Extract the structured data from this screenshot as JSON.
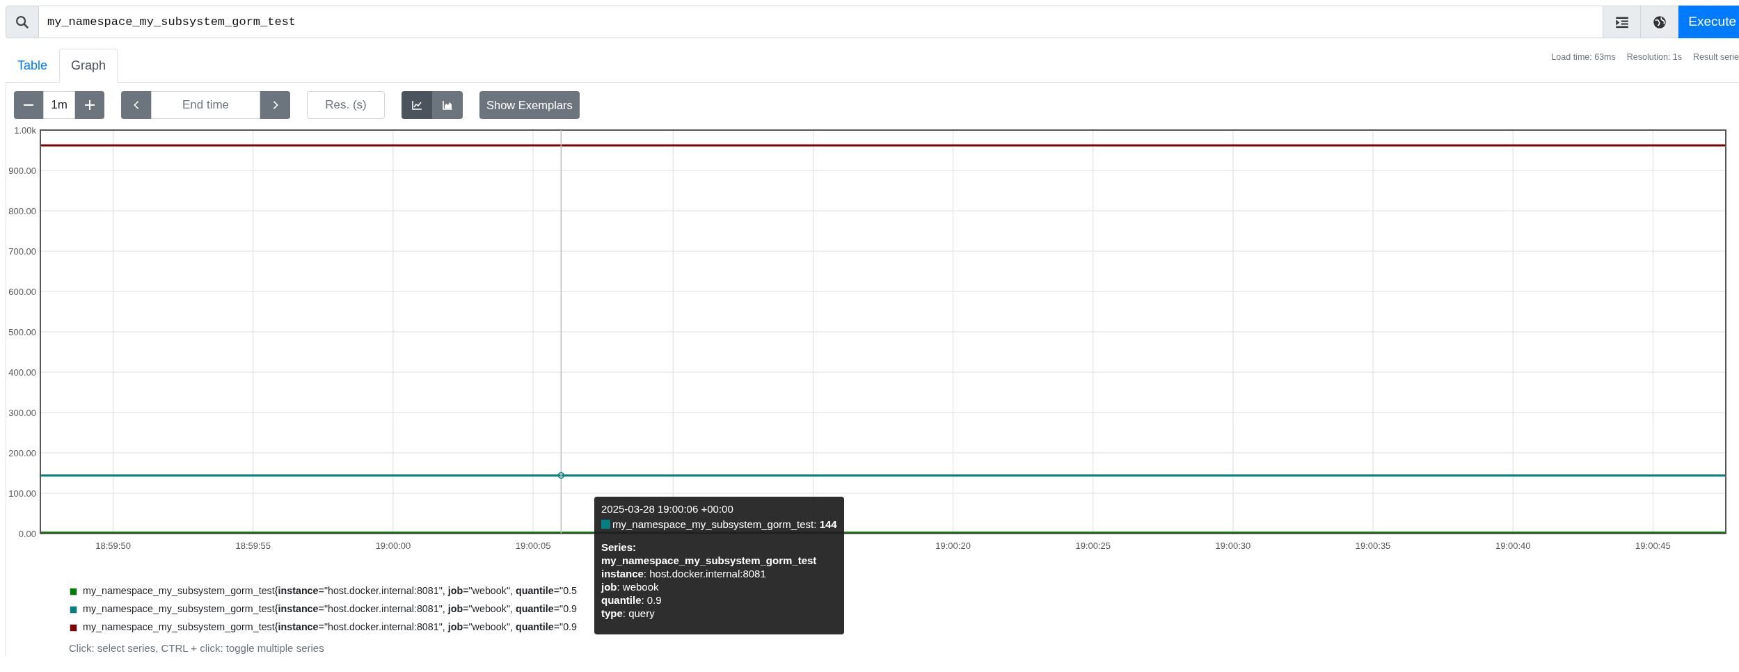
{
  "query_bar": {
    "value": "my_namespace_my_subsystem_gorm_test",
    "execute_label": "Execute"
  },
  "tabs": [
    {
      "label": "Table",
      "selected": false
    },
    {
      "label": "Graph",
      "selected": true
    }
  ],
  "stats": [
    "Load time: 63ms",
    "Resolution: 1s",
    "Result serie"
  ],
  "controls": {
    "range": "1m",
    "end_time_placeholder": "End time",
    "resolution_placeholder": "Res. (s)",
    "chart_modes": [
      {
        "kind": "lines",
        "selected": true
      },
      {
        "kind": "stacked",
        "selected": false
      }
    ],
    "exemplars_label": "Show Exemplars"
  },
  "graph": {
    "chart_data": {
      "type": "line",
      "x": [
        68387.4,
        68447.6
      ],
      "series": [
        {
          "color": "#008000",
          "values": [
            2,
            2
          ]
        },
        {
          "color": "#008080",
          "values": [
            144,
            144
          ]
        },
        {
          "color": "#800000",
          "values": [
            962,
            962
          ]
        }
      ],
      "xlim": [
        68387.4,
        68447.6
      ],
      "ylim": [
        0,
        1000
      ],
      "grid": true,
      "xticks": [
        {
          "value": 68390,
          "label": "18:59:50"
        },
        {
          "value": 68395,
          "label": "18:59:55"
        },
        {
          "value": 68400,
          "label": "19:00:00"
        },
        {
          "value": 68405,
          "label": "19:00:05"
        },
        {
          "value": 68420,
          "label": "19:00:20"
        },
        {
          "value": 68425,
          "label": "19:00:25"
        },
        {
          "value": 68430,
          "label": "19:00:30"
        },
        {
          "value": 68435,
          "label": "19:00:35"
        },
        {
          "value": 68440,
          "label": "19:00:40"
        },
        {
          "value": 68445,
          "label": "19:00:45"
        }
      ],
      "yticks": [
        {
          "value": 0,
          "label": "0.00"
        },
        {
          "value": 100,
          "label": "100.00"
        },
        {
          "value": 200,
          "label": "200.00"
        },
        {
          "value": 300,
          "label": "300.00"
        },
        {
          "value": 400,
          "label": "400.00"
        },
        {
          "value": 500,
          "label": "500.00"
        },
        {
          "value": 600,
          "label": "600.00"
        },
        {
          "value": 700,
          "label": "700.00"
        },
        {
          "value": 800,
          "label": "800.00"
        },
        {
          "value": 900,
          "label": "900.00"
        },
        {
          "value": 1000,
          "label": "1.00k"
        }
      ],
      "ref_lines": [
        {
          "axis": "x",
          "value": 68406
        }
      ]
    }
  },
  "tooltip": {
    "time": "2025-03-28 19:00:06 +00:00",
    "color": "#008080",
    "value_line": "my_namespace_my_subsystem_gorm_test: **144**",
    "series_heading": "Series:",
    "metric": "my_namespace_my_subsystem_gorm_test",
    "labels": [
      "**instance**: host.docker.internal:8081",
      "**job**: webook",
      "**quantile**: 0.9",
      "**type**: query"
    ]
  },
  "legend": [
    {
      "color": "#008000",
      "text": "my_namespace_my_subsystem_gorm_test{**instance**=\"host.docker.internal:8081\", **job**=\"webook\", **quantile**=\"0.5"
    },
    {
      "color": "#008080",
      "text": "my_namespace_my_subsystem_gorm_test{**instance**=\"host.docker.internal:8081\", **job**=\"webook\", **quantile**=\"0.9"
    },
    {
      "color": "#800000",
      "text": "my_namespace_my_subsystem_gorm_test{**instance**=\"host.docker.internal:8081\", **job**=\"webook\", **quantile**=\"0.9"
    }
  ],
  "help": "Click: select series, CTRL + click: toggle multiple series"
}
